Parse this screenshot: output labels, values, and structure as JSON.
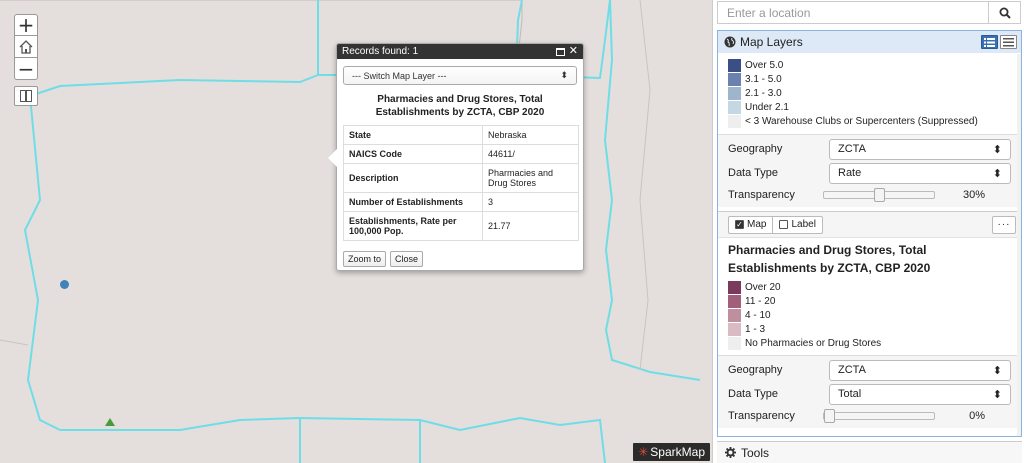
{
  "map": {
    "zoom_in": "+",
    "zoom_out": "−",
    "logo_text": "SparkMap",
    "popup": {
      "title_bar": "Records found: 1",
      "switch_layer": "--- Switch Map Layer ---",
      "heading": "Pharmacies and Drug Stores, Total Establishments by ZCTA, CBP 2020",
      "rows": [
        {
          "key": "State",
          "value": "Nebraska"
        },
        {
          "key": "NAICS Code",
          "value": "44611/"
        },
        {
          "key": "Description",
          "value": "Pharmacies and Drug Stores"
        },
        {
          "key": "Number of Establishments",
          "value": "3"
        },
        {
          "key": "Establishments, Rate per 100,000 Pop.",
          "value": "21.77"
        }
      ],
      "zoom_to": "Zoom to",
      "close": "Close"
    }
  },
  "search": {
    "placeholder": "Enter a location"
  },
  "layers_panel": {
    "title": "Map Layers",
    "layer1": {
      "legend": [
        {
          "label": "Over 5.0",
          "color": "#3a4f86"
        },
        {
          "label": "3.1 - 5.0",
          "color": "#6a82ad"
        },
        {
          "label": "2.1 - 3.0",
          "color": "#9fb5cc"
        },
        {
          "label": "Under 2.1",
          "color": "#c4d7e2"
        },
        {
          "label": "< 3 Warehouse Clubs or Supercenters (Suppressed)",
          "color": "#eeeeee"
        }
      ],
      "geography_label": "Geography",
      "geography_value": "ZCTA",
      "data_type_label": "Data Type",
      "data_type_value": "Rate",
      "transparency_label": "Transparency",
      "transparency_value": "30%",
      "transparency_fraction": 0.3
    },
    "layer2": {
      "map_toggle": "Map",
      "label_toggle": "Label",
      "more": "···",
      "title": "Pharmacies and Drug Stores, Total Establishments by ZCTA, CBP 2020",
      "legend": [
        {
          "label": "Over 20",
          "color": "#7a3a5c"
        },
        {
          "label": "11 - 20",
          "color": "#a0607c"
        },
        {
          "label": "4 - 10",
          "color": "#bf8e9f"
        },
        {
          "label": "1 - 3",
          "color": "#d9bcc3"
        },
        {
          "label": "No Pharmacies or Drug Stores",
          "color": "#eeeeee"
        }
      ],
      "geography_label": "Geography",
      "geography_value": "ZCTA",
      "data_type_label": "Data Type",
      "data_type_value": "Total",
      "transparency_label": "Transparency",
      "transparency_value": "0%",
      "transparency_fraction": 0
    }
  },
  "tools": {
    "label": "Tools"
  },
  "colors": {
    "boundary": "#6fdde6",
    "map_fill": "#e8e2e0",
    "panel_header": "#dde9f6"
  }
}
